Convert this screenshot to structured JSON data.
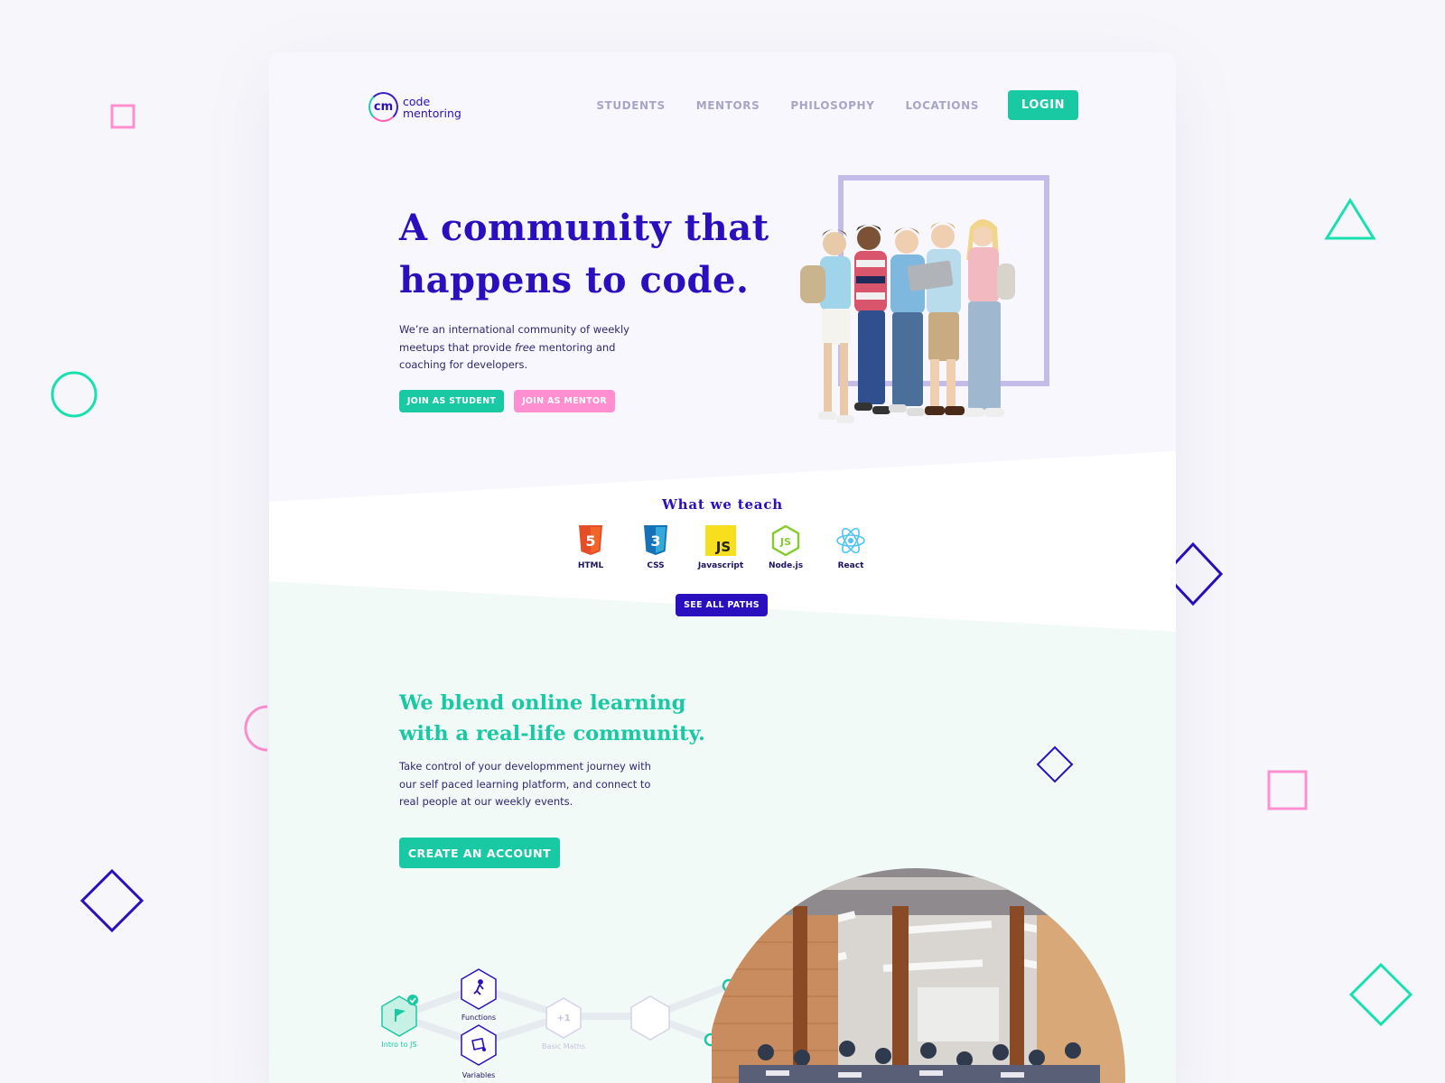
{
  "nav": {
    "logo_mark": "cm",
    "logo_line1": "code",
    "logo_line2": "mentoring",
    "links": [
      "STUDENTS",
      "MENTORS",
      "PHILOSOPHY",
      "LOCATIONS"
    ],
    "login": "LOGIN"
  },
  "hero": {
    "title_line1": "A community that",
    "title_line2": "happens to code.",
    "desc_pre": "We’re an international community of weekly meetups that provide",
    "desc_em": "free",
    "desc_post": "mentoring and coaching for developers.",
    "btn_student": "JOIN AS STUDENT",
    "btn_mentor": "JOIN AS MENTOR"
  },
  "teach": {
    "title": "What we teach",
    "items": [
      {
        "label": "HTML",
        "icon": "html5-icon",
        "badge": "5",
        "color": "#e44d26"
      },
      {
        "label": "CSS",
        "icon": "css3-icon",
        "badge": "3",
        "color": "#1f72c8"
      },
      {
        "label": "Javascript",
        "icon": "javascript-icon",
        "badge": "JS",
        "color": "#f7df1e"
      },
      {
        "label": "Node.js",
        "icon": "nodejs-icon",
        "badge": "JS",
        "color": "#83cd29"
      },
      {
        "label": "React",
        "icon": "react-icon",
        "badge": "",
        "color": "#4fc3f7"
      }
    ],
    "see_all": "SEE ALL PATHS"
  },
  "blend": {
    "title_line1": "We blend online learning",
    "title_line2": "with a real-life community.",
    "desc": "Take control of your developmment journey with our self paced learning platform, and connect to real people at our weekly events.",
    "create": "CREATE AN ACCOUNT"
  },
  "path": {
    "nodes": [
      {
        "label": "Intro to JS",
        "icon": "flag-icon",
        "state": "done"
      },
      {
        "label": "Functions",
        "icon": "runner-icon",
        "state": "available"
      },
      {
        "label": "Variables",
        "icon": "box-icon",
        "state": "available"
      },
      {
        "label": "Basic Maths",
        "icon": "plus-one-icon",
        "state": "locked",
        "badge": "+1"
      },
      {
        "label": "",
        "icon": "hexagon-icon",
        "state": "locked"
      }
    ]
  },
  "colors": {
    "primary": "#2a0fbf",
    "accent": "#19c9a3",
    "pink": "#ff8fd0",
    "lavender": "#c3bbe8",
    "mint_bg": "#f2faf8",
    "lav_bg": "#f8f7fd"
  }
}
